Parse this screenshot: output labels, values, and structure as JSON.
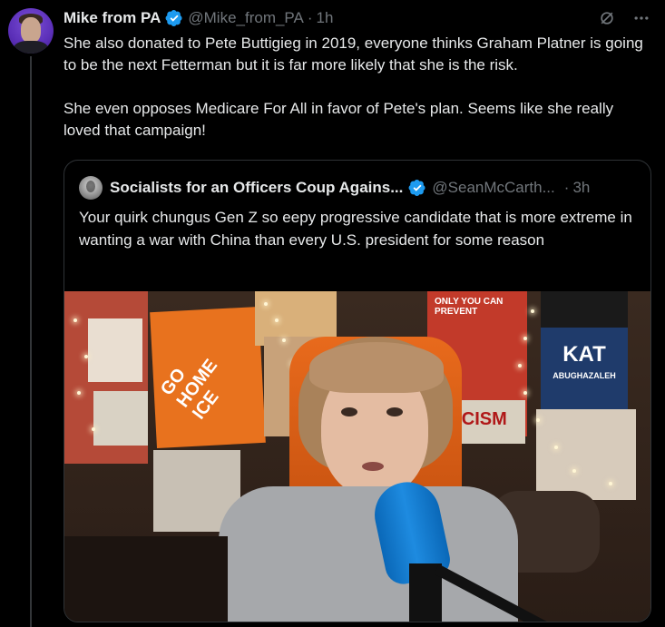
{
  "tweet": {
    "author_name": "Mike from PA",
    "handle": "@Mike_from_PA",
    "separator": "·",
    "time": "1h",
    "paragraphs": [
      "She also donated to Pete Buttigieg in 2019, everyone thinks Graham Platner is going to be the next Fetterman but it is far more likely that she is the risk.",
      "She even opposes Medicare For All in favor of Pete's plan. Seems like she really loved that campaign!"
    ],
    "verified": true
  },
  "quoted": {
    "author_name": "Socialists for an Officers Coup Agains...",
    "handle": "@SeanMcCarth...",
    "separator": "·",
    "time": "3h",
    "text": "Your quirk chungus Gen Z so eepy progressive candidate that is more extreme in wanting a war with China than every U.S. president for some reason",
    "verified": true
  },
  "media": {
    "poster_home": "GO\nHOME\nICE",
    "poster_kat_title": "KAT",
    "poster_kat_sub": "ABUGHAZALEH",
    "poster_fascism": "ASCISM",
    "poster_red_top": "ONLY YOU CAN PREVENT"
  },
  "icons": {
    "grok": "grok-icon",
    "more": "more-icon",
    "verified": "verified-badge-icon"
  },
  "colors": {
    "background": "#000000",
    "text": "#e7e9ea",
    "muted": "#71767b",
    "verified": "#1d9bf0",
    "border": "#2f3336"
  }
}
